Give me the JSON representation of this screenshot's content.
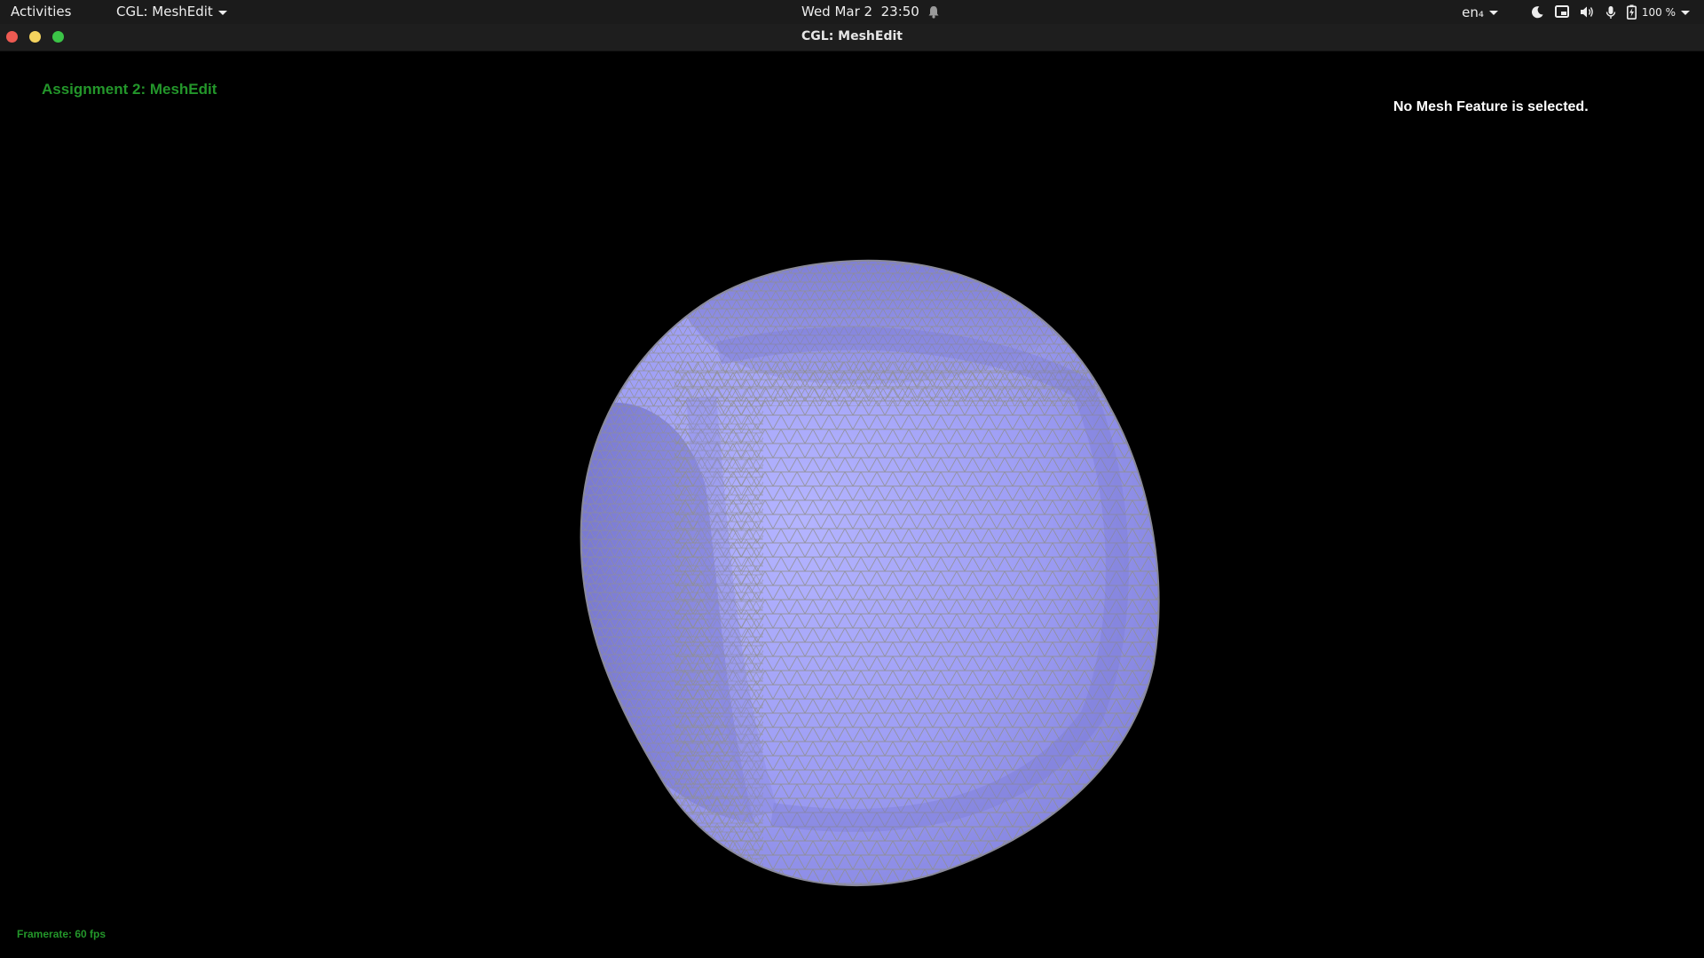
{
  "topbar": {
    "activities": "Activities",
    "app_menu": "CGL: MeshEdit",
    "clock": "Wed Mar 2  23:50",
    "language": "en₄",
    "battery": "100 %"
  },
  "window": {
    "title": "CGL: MeshEdit"
  },
  "viewport": {
    "assignment_title": "Assignment 2: MeshEdit",
    "selection_status": "No Mesh Feature is selected.",
    "framerate": "Framerate: 60 fps"
  },
  "icons": [
    "bell-icon",
    "night-light-icon",
    "screen-share-icon",
    "volume-icon",
    "microphone-icon",
    "battery-charging-icon"
  ],
  "colors": {
    "mesh_fill": "#a9a9ff",
    "mesh_wire": "#8f8f8f",
    "overlay_green": "#23962a"
  }
}
